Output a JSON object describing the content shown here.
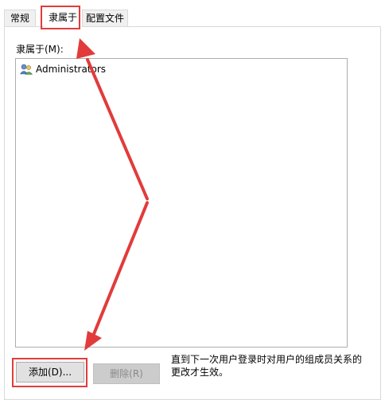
{
  "tabs": {
    "general": "常规",
    "member_of": "隶属于",
    "profile": "配置文件"
  },
  "member_of_label": "隶属于(M):",
  "members": [
    {
      "name": "Administrators",
      "icon": "user-group-icon"
    }
  ],
  "buttons": {
    "add": "添加(D)...",
    "remove": "删除(R)"
  },
  "note": "直到下一次用户登录时对用户的组成员关系的更改才生效。",
  "colors": {
    "annotation_red": "#e23b3b"
  }
}
